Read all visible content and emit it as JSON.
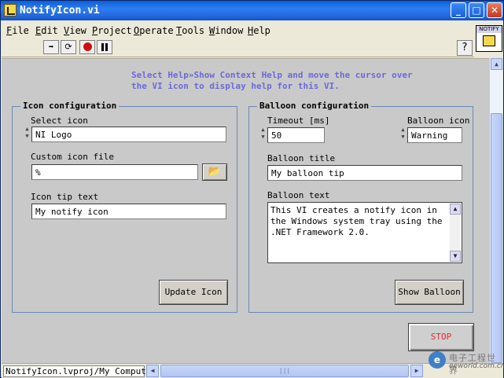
{
  "window": {
    "title": "NotifyIcon.vi",
    "minimize": "_",
    "maximize": "□",
    "close": "✕"
  },
  "menu": [
    "File",
    "Edit",
    "View",
    "Project",
    "Operate",
    "Tools",
    "Window",
    "Help"
  ],
  "toolbar": {
    "run_icon": "run-arrow-icon",
    "run_continuous_icon": "run-continuously-icon",
    "abort_icon": "abort-icon",
    "pause_icon": "pause-icon",
    "help_label": "?"
  },
  "vi_icon": {
    "text": "NOTIFY"
  },
  "help_note": "Select Help»Show Context Help and move the cursor over the VI icon to display help for this VI.",
  "icon_config": {
    "title": "Icon configuration",
    "select_icon_label": "Select icon",
    "select_icon_value": "NI Logo",
    "custom_file_label": "Custom icon file",
    "custom_file_prefix": "%",
    "custom_file_value": "",
    "tip_label": "Icon tip text",
    "tip_value": "My notify icon",
    "update_button": "Update Icon"
  },
  "balloon_config": {
    "title": "Balloon configuration",
    "timeout_label": "Timeout [ms]",
    "timeout_value": "50",
    "icon_label": "Balloon icon",
    "icon_value": "Warning",
    "title_label": "Balloon title",
    "title_value": "My balloon tip",
    "text_label": "Balloon text",
    "text_value": "This VI creates a notify icon in the Windows system tray using the .NET Framework 2.0.",
    "show_button": "Show Balloon"
  },
  "stop_button": "STOP",
  "status": {
    "project_path": "NotifyIcon.lvproj/My Computer"
  },
  "watermark": {
    "cn": "电子工程世界",
    "url": "eeworld.com.cn"
  },
  "colors": {
    "help_note": "#6a6ad8",
    "stop_text": "#e03030",
    "group_border": "#6a8ab4",
    "panel_bg": "#c9c9c9"
  }
}
